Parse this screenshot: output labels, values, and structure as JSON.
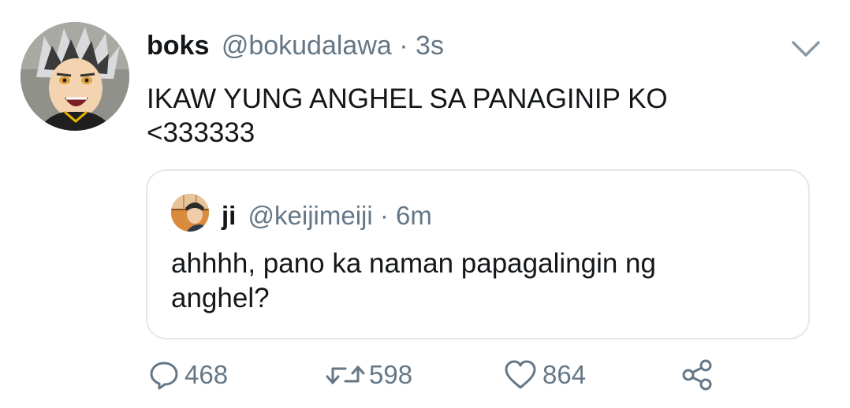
{
  "tweet": {
    "author_name": "boks",
    "author_handle": "@bokudalawa",
    "separator": "·",
    "timestamp": "3s",
    "text_line1": "IKAW YUNG ANGHEL SA PANAGINIP KO",
    "text_line2": "<333333",
    "menu_icon": "chevron-down-icon"
  },
  "quoted_tweet": {
    "author_name": "ji",
    "author_handle": "@keijimeiji",
    "separator": "·",
    "timestamp": "6m",
    "text_line1": "ahhhh, pano ka naman papagalingin ng",
    "text_line2": "anghel?"
  },
  "actions": {
    "reply": {
      "icon": "reply-icon",
      "count": "468"
    },
    "retweet": {
      "icon": "retweet-icon",
      "count": "598"
    },
    "like": {
      "icon": "heart-icon",
      "count": "864"
    },
    "share": {
      "icon": "share-icon"
    }
  },
  "colors": {
    "text": "#14171a",
    "secondary": "#657786",
    "border": "#e1e8ed",
    "background": "#ffffff"
  }
}
